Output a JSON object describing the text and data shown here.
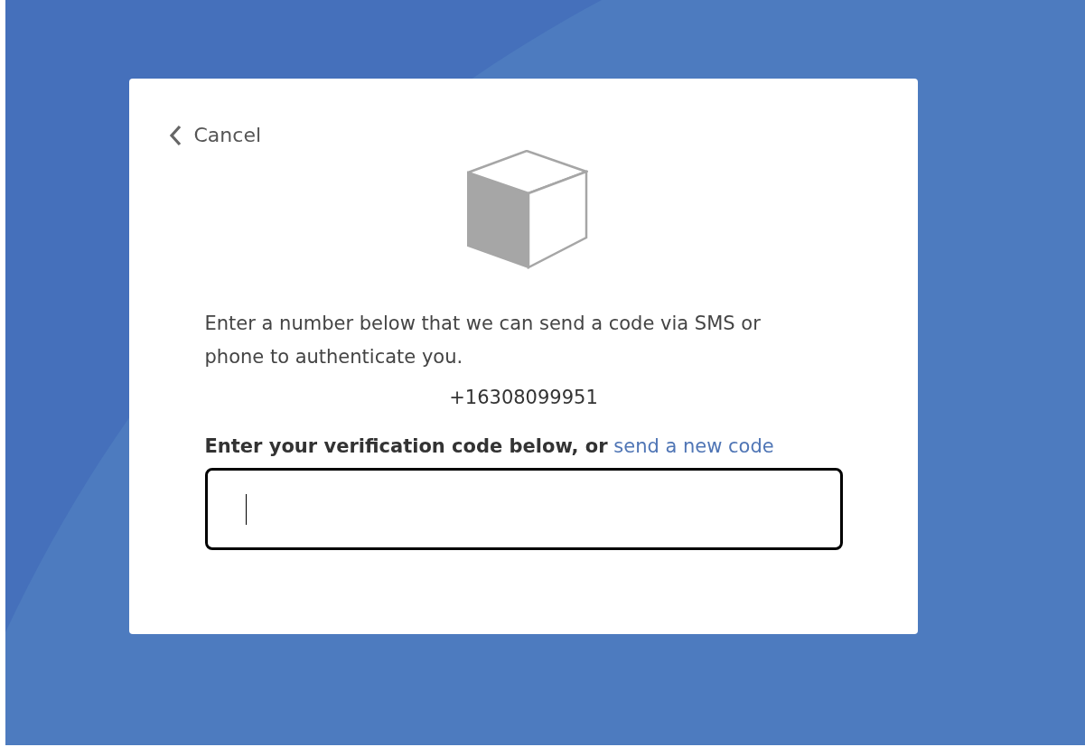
{
  "back_link": {
    "label": "Cancel"
  },
  "instructions": "Enter a number below that we can send a code via SMS or phone to authenticate you.",
  "phone_number": "+16308099951",
  "code_label": {
    "text": "**Enter your verification code below, or**",
    "link": "send a new code"
  },
  "code_field": {
    "focused": true
  }
}
